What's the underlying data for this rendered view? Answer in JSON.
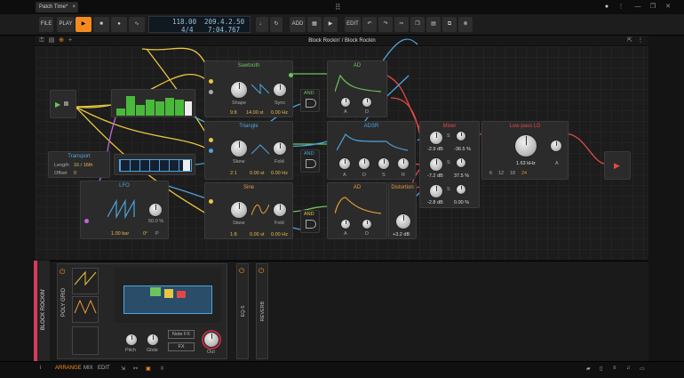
{
  "window": {
    "tab_label": "Patch Time*",
    "tab_close": "×",
    "menu_icon": "⋮",
    "min": "—",
    "max": "❐",
    "close": "✕"
  },
  "transport": {
    "file": "FILE",
    "play_label": "PLAY",
    "tempo": "118.00",
    "time_sig": "4/4",
    "position": "209.4.2.50",
    "time": "7:04.767",
    "add": "ADD",
    "edit": "EDIT"
  },
  "editor": {
    "title": "Block Rockin' / Block Rockin",
    "modules": {
      "sawtooth": {
        "title": "Sawtooth",
        "shape": "Shape",
        "sync": "Sync",
        "ratio": "9:8",
        "st": "14.00 st",
        "hz": "0.00 Hz"
      },
      "triangle": {
        "title": "Triangle",
        "skew": "Skew",
        "fold": "Fold",
        "ratio": "2:1",
        "st": "0.00 st",
        "hz": "0.00 Hz"
      },
      "sine": {
        "title": "Sine",
        "skew": "Skew",
        "fold": "Fold",
        "ratio": "1:8",
        "st": "0.00 st",
        "hz": "0.00 Hz"
      },
      "ad1": {
        "title": "AD",
        "a": "A",
        "d": "D"
      },
      "adsr": {
        "title": "ADSR",
        "a": "A",
        "d": "D",
        "s": "S",
        "r": "R"
      },
      "ad2": {
        "title": "AD",
        "a": "A",
        "d": "D"
      },
      "distortion": {
        "title": "Distortion",
        "value": "+3.2 dB"
      },
      "mixer": {
        "title": "Mixer",
        "ch1": "-2.9 dB",
        "ch1_pan": "-36.5 %",
        "ch2": "-7.2 dB",
        "ch2_pan": "37.5 %",
        "ch3": "-2.8 dB",
        "ch3_pan": "0.00 %",
        "s": "S"
      },
      "lowpass": {
        "title": "Low-pass LD",
        "freq": "1.63 kHz",
        "slopes": [
          "6",
          "12",
          "18",
          "24"
        ],
        "a": "A"
      },
      "transport": {
        "title": "Transport",
        "length_label": "Length",
        "length_value": "16 / 16th",
        "offset_label": "Offset",
        "offset_value": "0"
      },
      "lfo": {
        "title": "LFO",
        "pct": "50.0 %",
        "rate": "1.00 bar",
        "phase": "0°",
        "p": "P"
      },
      "and1": "AND",
      "and2": "AND",
      "and3": "AND"
    }
  },
  "bottom": {
    "track_name": "BLOCK ROCKIN'",
    "device_name": "POLY GRID",
    "pitch": "Pitch",
    "glide": "Glide",
    "note_fx": "Note FX",
    "fx": "FX",
    "out": "Out",
    "eq": "EQ-5",
    "reverb": "REVERB"
  },
  "status": {
    "arrange": "ARRANGE",
    "mix": "MIX",
    "edit": "EDIT"
  },
  "colors": {
    "accent_orange": "#f58a1f",
    "green": "#6cc45c",
    "blue": "#4fa3dd",
    "yellow": "#e8c640",
    "red": "#e04848",
    "purple": "#c066e0",
    "track_red": "#d83b5a"
  }
}
